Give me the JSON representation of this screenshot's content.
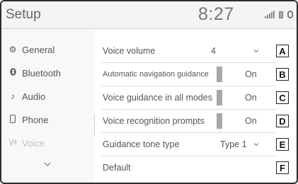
{
  "header": {
    "title": "Setup",
    "time": "8:27"
  },
  "status_icons": [
    "signal-icon",
    "battery-icon",
    "alert-icon"
  ],
  "sidebar": {
    "items": [
      {
        "label": "General",
        "icon": "gear-icon",
        "active": false
      },
      {
        "label": "Bluetooth",
        "icon": "bluetooth-icon",
        "active": false
      },
      {
        "label": "Audio",
        "icon": "music-note-icon",
        "active": false
      },
      {
        "label": "Phone",
        "icon": "phone-icon",
        "active": false
      },
      {
        "label": "Voice",
        "icon": "voice-icon",
        "active": true
      }
    ],
    "more_icon": "chevron-down-icon"
  },
  "settings": [
    {
      "label": "Voice volume",
      "value": "4",
      "control": "dropdown",
      "tag": "A"
    },
    {
      "label": "Automatic navigation guidance",
      "value": "On",
      "control": "toggle",
      "tag": "B"
    },
    {
      "label": "Voice guidance in all modes",
      "value": "On",
      "control": "toggle",
      "tag": "C"
    },
    {
      "label": "Voice recognition prompts",
      "value": "On",
      "control": "toggle",
      "tag": "D"
    },
    {
      "label": "Guidance tone type",
      "value": "Type 1",
      "control": "dropdown",
      "tag": "E"
    },
    {
      "label": "Default",
      "value": "",
      "control": "button",
      "tag": "F"
    }
  ],
  "colors": {
    "indicator": "#a8a8a8",
    "active_sidebar_text": "#bdbdbd"
  }
}
